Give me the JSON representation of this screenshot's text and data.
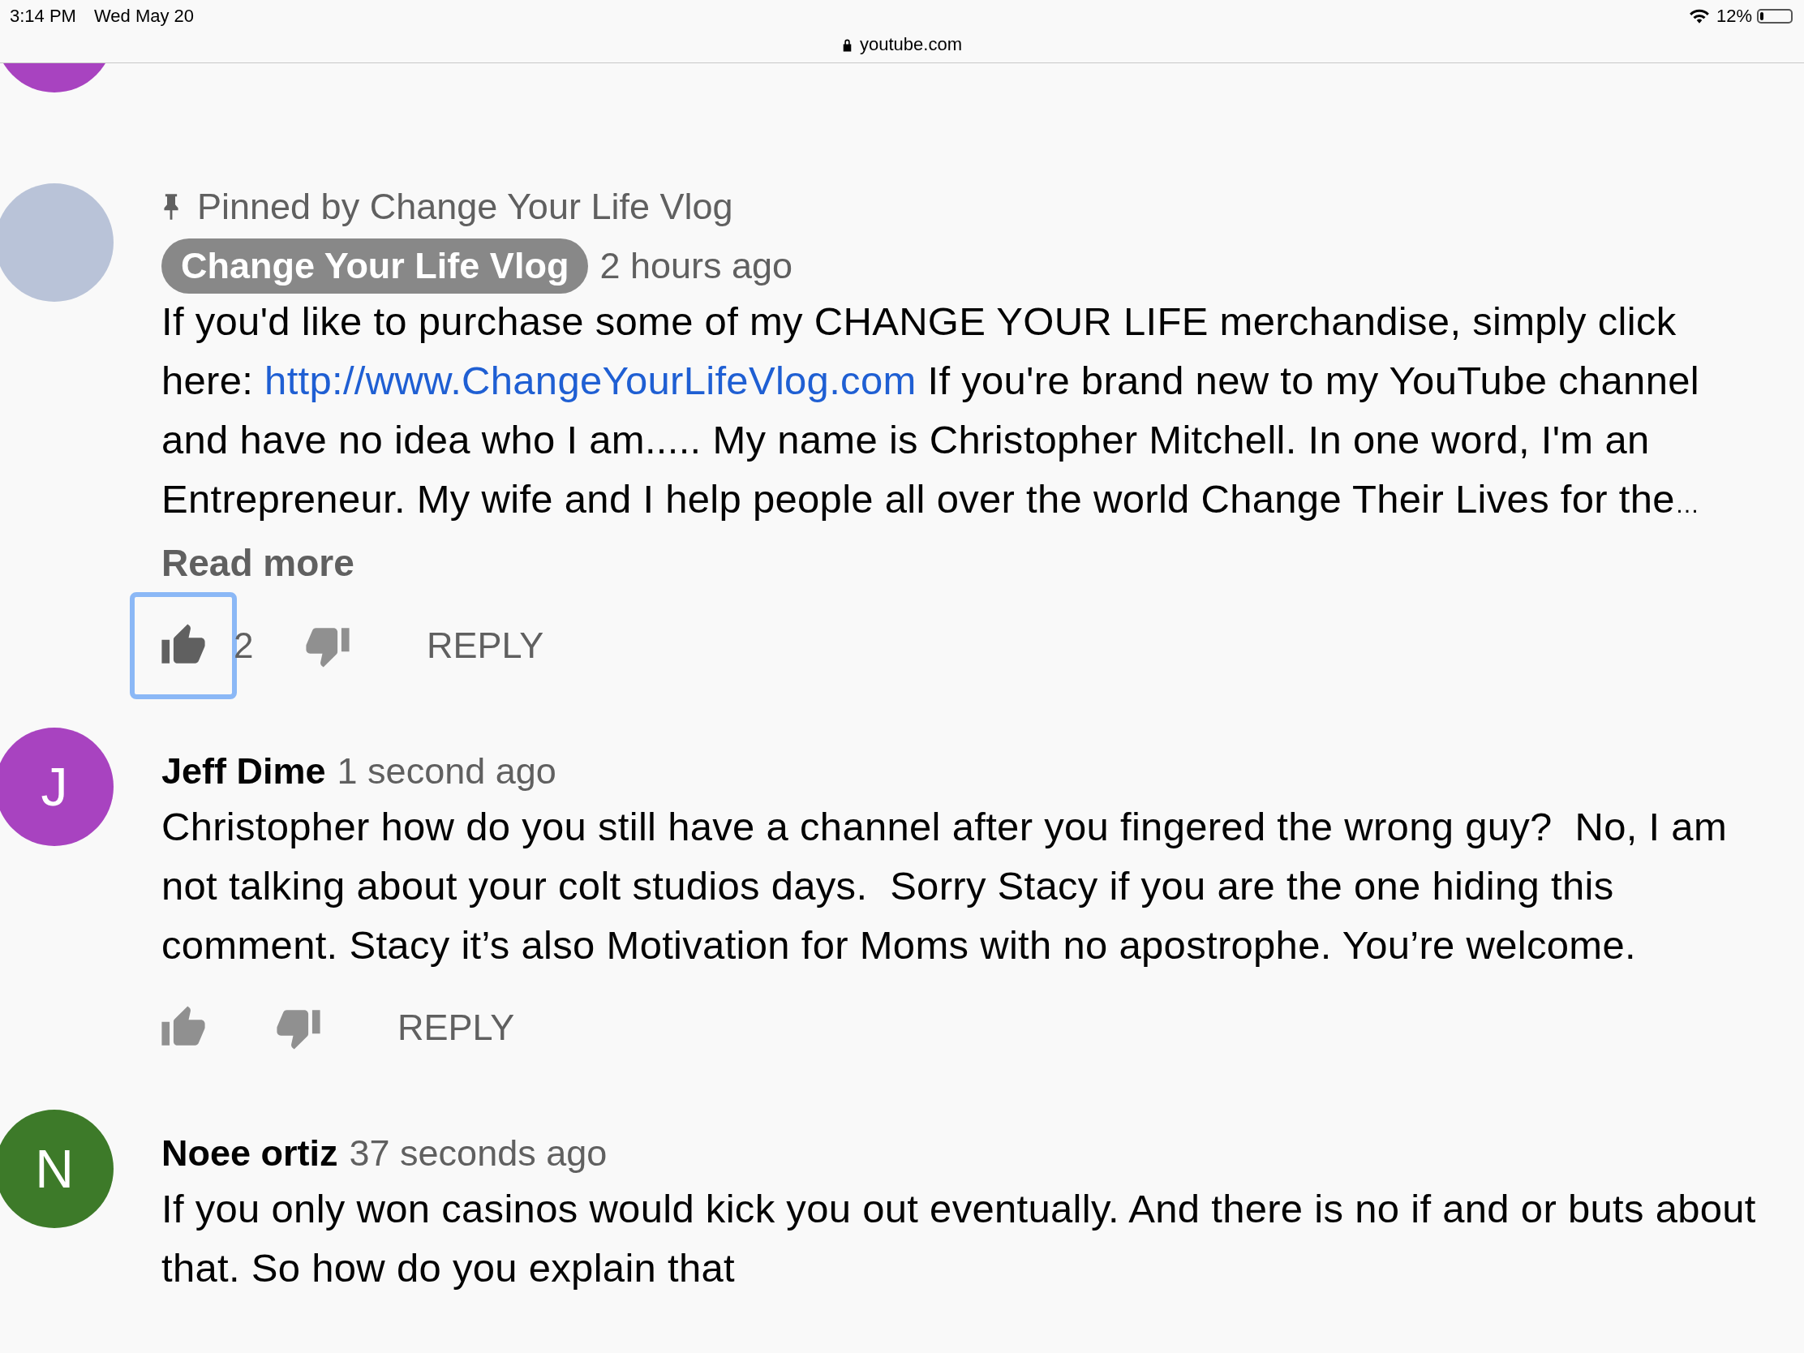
{
  "status_bar": {
    "time": "3:14 PM",
    "date": "Wed May 20",
    "url": "youtube.com",
    "battery": "12%"
  },
  "comments": [
    {
      "avatar": {
        "kind": "photo"
      },
      "pinned_by": "Pinned by Change Your Life Vlog",
      "author": "Change Your Life Vlog",
      "author_badge": true,
      "time": "2 hours ago",
      "body": [
        {
          "kind": "text",
          "text": "If you'd like to purchase some of my CHANGE YOUR LIFE merchandise, simply click here: "
        },
        {
          "kind": "link",
          "text": "http://www.ChangeYourLifeVlog.com"
        },
        {
          "kind": "text",
          "text": " If you're brand new to my YouTube channel and have no idea who I am..... My name is Christopher Mitchell. In one word, I'm an Entrepreneur. My wife and I help people all over the world Change Their Lives for the"
        }
      ],
      "ellipsis": "…",
      "read_more": "Read more",
      "actions": {
        "like_count": "2",
        "like_focused": true,
        "reply": "REPLY"
      }
    },
    {
      "avatar": {
        "kind": "letter",
        "letter": "J",
        "color": "#a843c0"
      },
      "author": "Jeff Dime",
      "author_badge": false,
      "time": "1 second ago",
      "body": [
        {
          "kind": "text",
          "text": "Christopher how do you still have a channel after you fingered the wrong guy?  No, I am not talking about your colt studios days.  Sorry Stacy if you are the one hiding this comment. Stacy it’s also Motivation for Moms with no apostrophe. You’re welcome."
        }
      ],
      "actions": {
        "like_focused": false,
        "reply": "REPLY"
      }
    },
    {
      "avatar": {
        "kind": "letter",
        "letter": "N",
        "color": "#3d7a29"
      },
      "author": "Noee ortiz",
      "author_badge": false,
      "time": "37 seconds ago",
      "body": [
        {
          "kind": "text",
          "text": "If you only won casinos would kick you out eventually. And there is no if and or buts about that. So how do you explain that"
        }
      ]
    }
  ]
}
